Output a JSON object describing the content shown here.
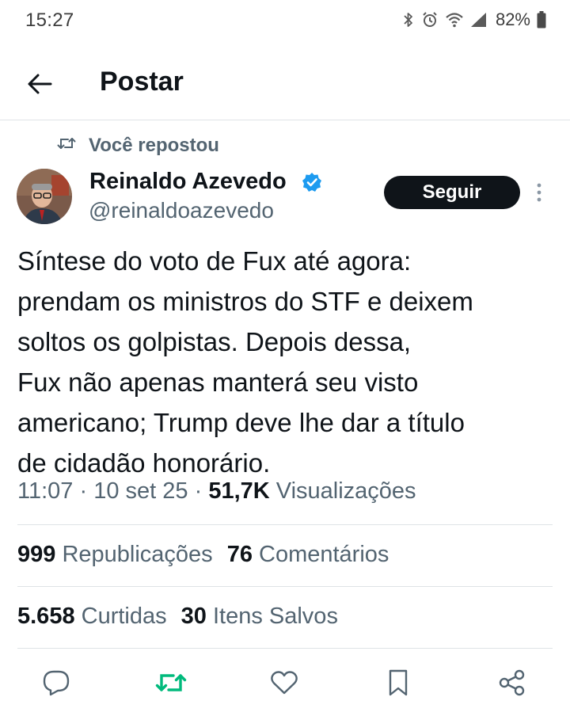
{
  "status_bar": {
    "time": "15:27",
    "battery": "82%",
    "icons": [
      "bluetooth-icon",
      "alarm-icon",
      "wifi-icon",
      "signal-icon",
      "battery-icon"
    ]
  },
  "header": {
    "back_icon": "arrow-left-icon",
    "title": "Postar"
  },
  "repost_notice": {
    "icon": "repost-icon",
    "text": "Você repostou"
  },
  "author": {
    "name": "Reinaldo Azevedo",
    "handle": "@reinaldoazevedo",
    "verified": true,
    "follow_label": "Seguir"
  },
  "tweet": {
    "lines": [
      "Síntese do voto de Fux até agora:",
      "prendam os ministros do STF e deixem",
      "soltos os golpistas. Depois dessa,",
      "Fux não apenas manterá seu visto",
      "americano; Trump deve lhe dar a título",
      "de cidadão honorário."
    ],
    "time": "11:07",
    "date": "10 set 25",
    "views_count": "51,7K",
    "views_label": "Visualizações"
  },
  "stats": {
    "reposts_count": "999",
    "reposts_label": "Republicações",
    "comments_count": "76",
    "comments_label": "Comentários",
    "likes_count": "5.658",
    "likes_label": "Curtidas",
    "saves_count": "30",
    "saves_label": "Itens Salvos"
  },
  "actions": [
    "reply-icon",
    "repost-icon",
    "like-icon",
    "bookmark-icon",
    "share-icon"
  ],
  "colors": {
    "text": "#0f1419",
    "secondary": "#536471",
    "verified": "#1d9bf0",
    "repost_active": "#00ba7c",
    "divider": "#dfe3e6",
    "button_bg": "#0f1419"
  }
}
